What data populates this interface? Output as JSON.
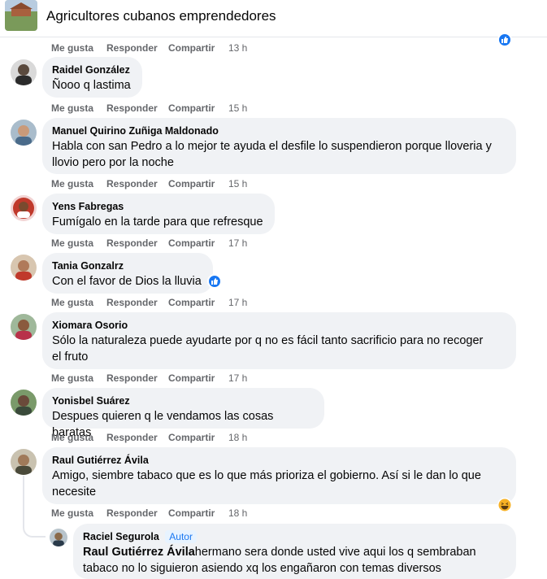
{
  "header": {
    "title": "Agricultores cubanos emprendedores"
  },
  "actions": {
    "like": "Me gusta",
    "reply": "Responder",
    "share": "Compartir"
  },
  "top_actions": {
    "time": "13 h"
  },
  "comments": [
    {
      "author": "Raidel González",
      "text": "Ñooo q lastima",
      "time": "15 h"
    },
    {
      "author": "Manuel Quirino Zuñiga Maldonado",
      "text_line1": "Habla con san Pedro a lo mejor te ayuda el desfile lo suspendieron porque lloveria y",
      "text_line2": "llovio pero por la noche",
      "time": "15 h"
    },
    {
      "author": "Yens Fabregas",
      "text": "Fumígalo en la tarde para que refresque",
      "time": "17 h"
    },
    {
      "author": "Tania Gonzalrz",
      "text": "Con el favor de Dios la lluvia",
      "time": "17 h"
    },
    {
      "author": "Xiomara Osorio",
      "text_line1": "Sólo la naturaleza puede ayudarte por q no es fácil tanto sacrificio para no recoger",
      "text_line2": "el fruto",
      "time": "17 h"
    },
    {
      "author": "Yonisbel Suárez",
      "text": "Despues quieren q le vendamos las cosas baratas",
      "time": "18 h"
    },
    {
      "author": "Raul Gutiérrez Ávila",
      "text_line1": "Amigo, siembre tabaco que es lo que más prioriza el gobierno. Así si le dan lo que",
      "text_line2": "necesite",
      "time": "18 h"
    }
  ],
  "reply": {
    "author": "Raciel Segurola",
    "badge": "Autor",
    "mention": "Raul Gutiérrez Ávila",
    "text_line1": "hermano sera donde usted vive aqui los q sembraban",
    "text_line2": "tabaco no lo siguieron asiendo xq los engañaron con temas diversos"
  },
  "colors": {
    "like_blue": "#1877f2",
    "bubble_bg": "#f0f2f5",
    "meta_gray": "#65676b"
  }
}
